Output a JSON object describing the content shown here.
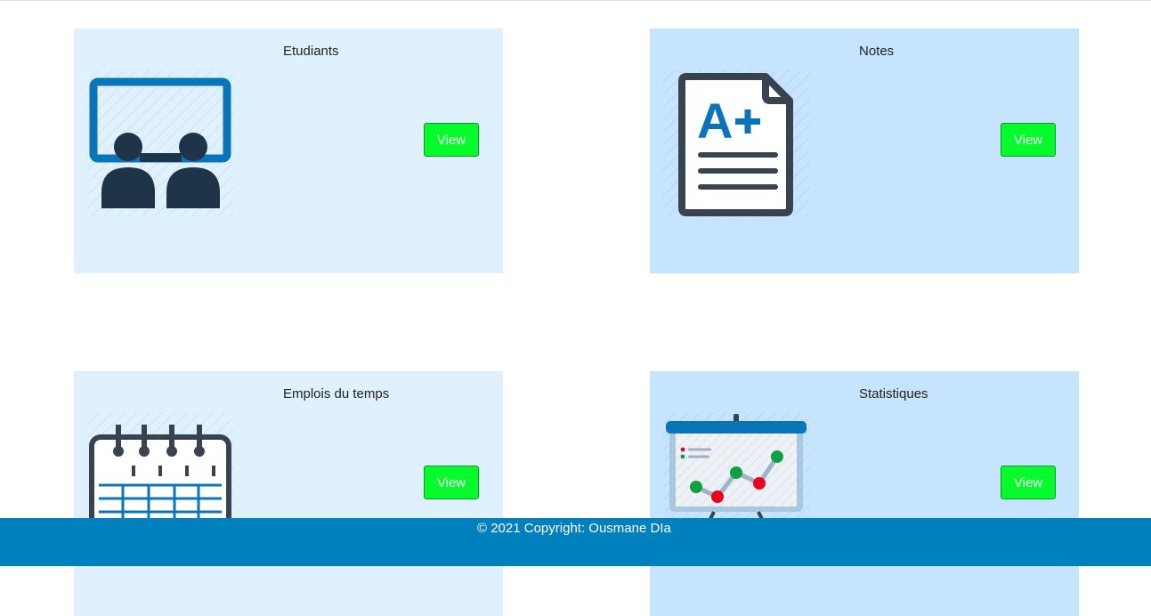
{
  "cards": [
    {
      "title": "Etudiants",
      "button": "View",
      "icon": "classroom-icon"
    },
    {
      "title": "Notes",
      "button": "View",
      "icon": "grade-document-icon"
    },
    {
      "title": "Emplois du temps",
      "button": "View",
      "icon": "calendar-icon"
    },
    {
      "title": "Statistiques",
      "button": "View",
      "icon": "statistics-board-icon"
    }
  ],
  "footer": {
    "text": "© 2021 Copyright: Ousmane DIa"
  },
  "colors": {
    "card_light": "#e0f1fe",
    "card_mid": "#c6e4fd",
    "button": "#05fb2c",
    "footer": "#0080bc",
    "icon_dark": "#1e3549",
    "icon_blue": "#0a74b9"
  }
}
